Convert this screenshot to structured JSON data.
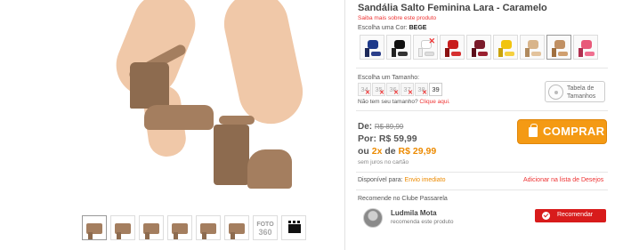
{
  "product": {
    "title": "Sandália Salto Feminina Lara - Caramelo",
    "know_more": "Saiba mais sobre este produto"
  },
  "color": {
    "label": "Escolha uma Cor:",
    "selected": "BEGE",
    "swatches": [
      {
        "icon": "sandal-navy-icon",
        "top": "#1e3a8a",
        "heel": "#1e2a5a",
        "sole": "#2b3f8a",
        "unavailable": false
      },
      {
        "icon": "sandal-black-icon",
        "top": "#111111",
        "heel": "#222222",
        "sole": "#333333",
        "unavailable": false
      },
      {
        "icon": "sandal-white-icon",
        "top": "#ffffff",
        "heel": "#eeeeee",
        "sole": "#dddddd",
        "unavailable": true
      },
      {
        "icon": "sandal-red-icon",
        "top": "#c81e1e",
        "heel": "#8a1010",
        "sole": "#d63030",
        "unavailable": false
      },
      {
        "icon": "sandal-wine-icon",
        "top": "#7a1a2a",
        "heel": "#5c0e1a",
        "sole": "#9a2030",
        "unavailable": false
      },
      {
        "icon": "sandal-yellow-icon",
        "top": "#f1c40f",
        "heel": "#c9a20a",
        "sole": "#f5d040",
        "unavailable": false
      },
      {
        "icon": "sandal-tan-icon",
        "top": "#d8b48a",
        "heel": "#b08a5e",
        "sole": "#e3c39c",
        "unavailable": false
      },
      {
        "icon": "sandal-caramel-icon",
        "top": "#c09063",
        "heel": "#a07040",
        "sole": "#d0a070",
        "unavailable": false
      },
      {
        "icon": "sandal-pink-icon",
        "top": "#e85a7a",
        "heel": "#b03050",
        "sole": "#f07090",
        "unavailable": false
      }
    ]
  },
  "size": {
    "label": "Escolha um Tamanho:",
    "options": [
      {
        "value": "34",
        "available": false
      },
      {
        "value": "35",
        "available": false
      },
      {
        "value": "36",
        "available": false
      },
      {
        "value": "37",
        "available": false
      },
      {
        "value": "38",
        "available": false
      },
      {
        "value": "39",
        "available": true
      }
    ],
    "help_text": "Não tem seu tamanho?",
    "help_link": "Clique aqui.",
    "table_btn_line1": "Tabela de",
    "table_btn_line2": "Tamanhos"
  },
  "price": {
    "from_label": "De:",
    "from_value": "R$ 89,99",
    "now_label": "Por:",
    "now_value": "R$ 59,99",
    "inst_prefix": "ou",
    "inst_times": "2x",
    "inst_de": "de",
    "inst_value": "R$ 29,99",
    "note": "sem juros no cartão"
  },
  "buy_label": "COMPRAR",
  "availability": {
    "label": "Disponível para:",
    "value": "Envio imediato",
    "wishlist": "Adicionar na lista de Desejos"
  },
  "recommend": {
    "head": "Recomende no Clube Passarela",
    "user_name": "Ludmila Mota",
    "user_sub": "recomenda este produto",
    "button": "Recomendar"
  },
  "gallery": {
    "thumb_360_label": "FOTO",
    "thumb_360_deg": "360"
  },
  "colors": {
    "accent_orange": "#f49a14",
    "accent_red": "#d81b1b",
    "shoe": "#a47e5f"
  }
}
